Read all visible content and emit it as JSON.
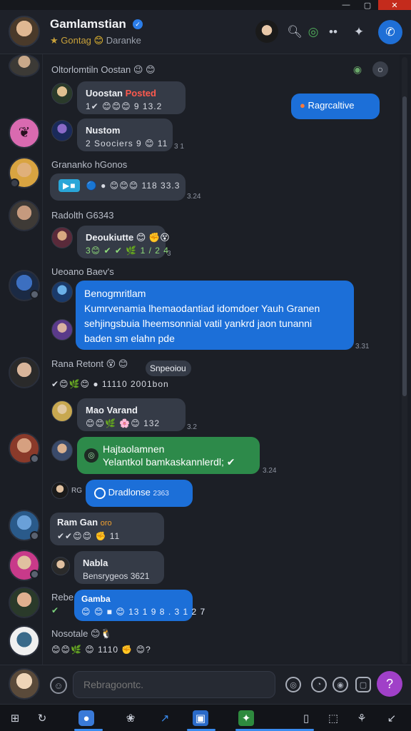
{
  "window": {
    "minimize": "—",
    "maximize": "▢",
    "close": "✕"
  },
  "header": {
    "title": "Gamlamstian",
    "verified": "✓",
    "status_label": "★ Gontag",
    "status_emoji": "😊",
    "status_text": "Daranke",
    "icons": [
      "avatar-icon",
      "search-icon",
      "globe-icon",
      "share-icon",
      "puzzle-icon",
      "call-icon"
    ]
  },
  "messages": [
    {
      "group": "Oltorlomtiln Oostan",
      "group_emoji": "😉 😊"
    },
    {
      "name": "Uoostan",
      "name_tag": "Posted",
      "meta": "1✔ 😊😊😊 9 13.2",
      "timestamp": ""
    },
    {
      "badge": "Ragrcaltive"
    },
    {
      "name": "Nustom",
      "meta": "2 Soociers 9 😊 11",
      "timestamp": "3 1"
    },
    {
      "group": "Grananko hGonos"
    },
    {
      "meta": "🔵 ● 😊😊😊 118  33.3",
      "timestamp": "3.24"
    },
    {
      "group": "Radolth G6343"
    },
    {
      "name": "Deoukiutte 😊 ✊😵",
      "meta": "3😊 ✔ ✔ 🌿 1 / 2 4",
      "timestamp": "3"
    },
    {
      "group": "Ueoano Baev's"
    },
    {
      "title": "Benogmritlam",
      "line1": "Kumrvenamia lhemaodantiad idomdoer Yauh Granen",
      "line2": "sehjingsbuia lheemsonnial vatil yankrd jaon tunanni",
      "line3": "baden sm elahn pde",
      "timestamp": "3.31"
    },
    {
      "group": "Rana Retont",
      "group_emoji": "😵 😊",
      "pill": "Snpeoiou",
      "meta": "✔😊🌿😊 ● 11110  2001bon"
    },
    {
      "name": "Mao Varand",
      "meta": "😊😊🌿 🌸😊 132",
      "timestamp": "3.2"
    },
    {
      "title": "Hajtaolamnen",
      "line1": "Yelantkol bamkaskannlerdl; ✔",
      "timestamp": "3.24"
    },
    {
      "sender_tag": "RG",
      "text": "Dradlonse",
      "meta": "2363"
    },
    {
      "group": "Ram Gan",
      "group_tag": "oro",
      "meta": "✔✔😊😊 ✊ 11"
    },
    {
      "name": "Nabla",
      "meta": "Bensrygeos 3621"
    },
    {
      "group": "Rebe",
      "name": "Gamba",
      "meta": "😊 😊 ■ 😊 13 1 9 8 . 3 1 2 7"
    },
    {
      "group": "Nosotale 😊🐧",
      "meta": "😊😊🌿 😊 1110 ✊ 😊?"
    }
  ],
  "composer": {
    "placeholder": "Rebragoontc.",
    "icons": [
      "emoji-icon",
      "attach-icon",
      "sticker-icon",
      "gif-icon",
      "mic-icon"
    ]
  },
  "taskbar": {
    "items": [
      "windows-icon",
      "search-icon",
      "chat-app-icon",
      "settings-icon",
      "edge-icon",
      "store-icon",
      "xbox-icon",
      "notes-icon",
      "capture-icon",
      "puzzle-icon",
      "help-icon"
    ]
  }
}
